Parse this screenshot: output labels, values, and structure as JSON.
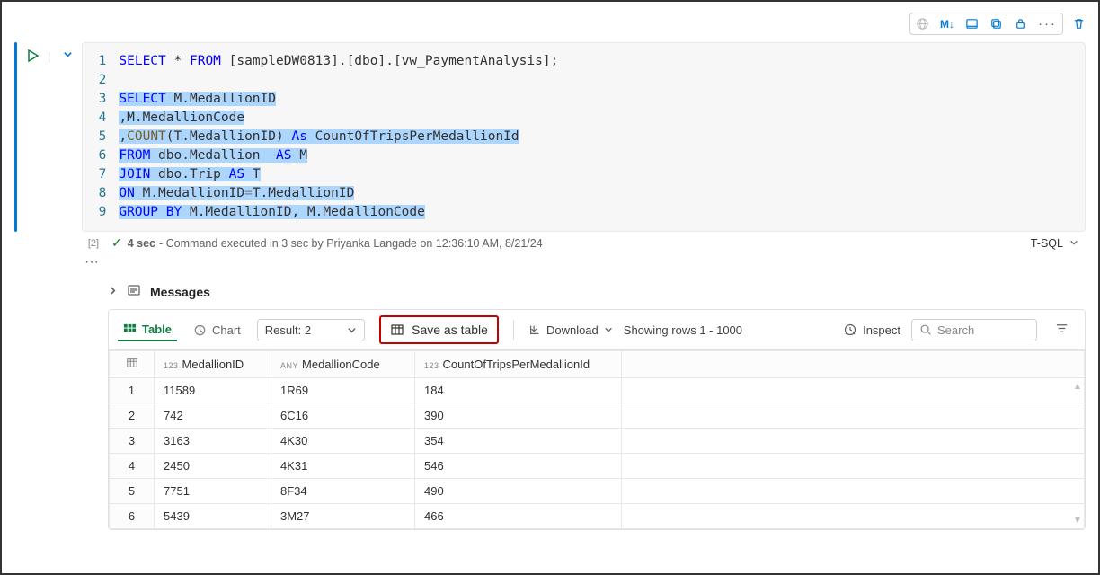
{
  "toolbar": {
    "md_label": "M↓"
  },
  "code": {
    "lines": [
      {
        "n": "1",
        "segments": [
          {
            "t": "SELECT",
            "c": "kw"
          },
          {
            "t": " * "
          },
          {
            "t": "FROM",
            "c": "kw"
          },
          {
            "t": " [sampleDW0813].[dbo].[vw_PaymentAnalysis];"
          }
        ]
      },
      {
        "n": "2",
        "segments": []
      },
      {
        "n": "3",
        "segments": [
          {
            "t": "SELECT",
            "c": "kw hl"
          },
          {
            "t": " M.MedallionID",
            "c": "hl"
          }
        ]
      },
      {
        "n": "4",
        "segments": [
          {
            "t": ",M.MedallionCode",
            "c": "hl"
          }
        ]
      },
      {
        "n": "5",
        "segments": [
          {
            "t": ",",
            "c": "hl"
          },
          {
            "t": "COUNT",
            "c": "fn hl"
          },
          {
            "t": "(T.MedallionID) ",
            "c": "hl"
          },
          {
            "t": "As",
            "c": "kw hl"
          },
          {
            "t": " CountOfTripsPerMedallionId",
            "c": "hl"
          }
        ]
      },
      {
        "n": "6",
        "segments": [
          {
            "t": "FROM",
            "c": "kw hl"
          },
          {
            "t": " dbo.Medallion  ",
            "c": "hl"
          },
          {
            "t": "AS",
            "c": "kw hl"
          },
          {
            "t": " M",
            "c": "hl"
          }
        ]
      },
      {
        "n": "7",
        "segments": [
          {
            "t": "JOIN",
            "c": "kw hl"
          },
          {
            "t": " dbo.Trip ",
            "c": "hl"
          },
          {
            "t": "AS",
            "c": "kw hl"
          },
          {
            "t": " T",
            "c": "hl"
          }
        ]
      },
      {
        "n": "8",
        "segments": [
          {
            "t": "ON",
            "c": "kw hl"
          },
          {
            "t": " M.MedallionID",
            "c": "hl"
          },
          {
            "t": "=",
            "c": "gray hl"
          },
          {
            "t": "T.MedallionID",
            "c": "hl"
          }
        ]
      },
      {
        "n": "9",
        "segments": [
          {
            "t": "GROUP BY",
            "c": "kw hl"
          },
          {
            "t": " M.MedallionID, M.MedallionCode",
            "c": "hl"
          }
        ]
      }
    ]
  },
  "status": {
    "cell_index": "[2]",
    "duration": "4 sec",
    "message": "- Command executed in 3 sec by Priyanka Langade on 12:36:10 AM, 8/21/24",
    "language": "T-SQL"
  },
  "messages": {
    "label": "Messages"
  },
  "results": {
    "tab_table": "Table",
    "tab_chart": "Chart",
    "result_select": "Result: 2",
    "save_as_table": "Save as table",
    "download": "Download",
    "showing": "Showing rows 1 - 1000",
    "inspect": "Inspect",
    "search_placeholder": "Search"
  },
  "table": {
    "columns": [
      {
        "type": "123",
        "name": "MedallionID"
      },
      {
        "type": "ANY",
        "name": "MedallionCode"
      },
      {
        "type": "123",
        "name": "CountOfTripsPerMedallionId"
      }
    ],
    "rows": [
      {
        "n": "1",
        "c": [
          "11589",
          "1R69",
          "184"
        ]
      },
      {
        "n": "2",
        "c": [
          "742",
          "6C16",
          "390"
        ]
      },
      {
        "n": "3",
        "c": [
          "3163",
          "4K30",
          "354"
        ]
      },
      {
        "n": "4",
        "c": [
          "2450",
          "4K31",
          "546"
        ]
      },
      {
        "n": "5",
        "c": [
          "7751",
          "8F34",
          "490"
        ]
      },
      {
        "n": "6",
        "c": [
          "5439",
          "3M27",
          "466"
        ]
      }
    ]
  }
}
